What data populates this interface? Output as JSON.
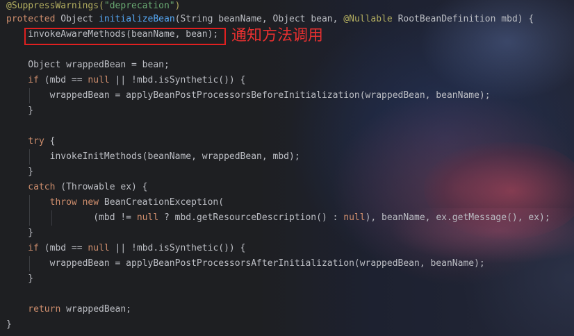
{
  "annotation_note": "通知方法调用",
  "colors": {
    "keyword": "#cf8e6d",
    "annotation": "#b3ae60",
    "string": "#6aab73",
    "function": "#56a8f5",
    "text": "#bcbec4",
    "highlight_box": "#e02020",
    "note_text": "#e53030"
  },
  "code": {
    "lines": [
      [
        [
          "ann",
          "@SuppressWarnings("
        ],
        [
          "str",
          "\"deprecation\""
        ],
        [
          "ann",
          ")"
        ]
      ],
      [
        [
          "kw",
          "protected "
        ],
        [
          "",
          "Object "
        ],
        [
          "fn",
          "initializeBean"
        ],
        [
          "",
          "(String beanName, Object bean, "
        ],
        [
          "ann",
          "@Nullable "
        ],
        [
          "",
          "RootBeanDefinition mbd) {"
        ]
      ],
      [
        [
          "",
          "    invokeAwareMethods(beanName, bean);"
        ]
      ],
      [],
      [
        [
          "",
          "    Object wrappedBean = bean;"
        ]
      ],
      [
        [
          "kw",
          "    if "
        ],
        [
          "",
          "(mbd == "
        ],
        [
          "kw",
          "null"
        ],
        [
          "",
          " || !mbd.isSynthetic()) {"
        ]
      ],
      [
        [
          "",
          "        wrappedBean = applyBeanPostProcessorsBeforeInitialization(wrappedBean, beanName);"
        ]
      ],
      [
        [
          "",
          "    }"
        ]
      ],
      [],
      [
        [
          "kw",
          "    try "
        ],
        [
          "",
          "{"
        ]
      ],
      [
        [
          "",
          "        invokeInitMethods(beanName, wrappedBean, mbd);"
        ]
      ],
      [
        [
          "",
          "    }"
        ]
      ],
      [
        [
          "kw",
          "    catch "
        ],
        [
          "",
          "(Throwable ex) {"
        ]
      ],
      [
        [
          "kw",
          "        throw new "
        ],
        [
          "",
          "BeanCreationException("
        ]
      ],
      [
        [
          "",
          "                (mbd != "
        ],
        [
          "kw",
          "null"
        ],
        [
          "",
          " ? mbd.getResourceDescription() : "
        ],
        [
          "kw",
          "null"
        ],
        [
          "",
          "), beanName, ex.getMessage(), ex);"
        ]
      ],
      [
        [
          "",
          "    }"
        ]
      ],
      [
        [
          "kw",
          "    if "
        ],
        [
          "",
          "(mbd == "
        ],
        [
          "kw",
          "null"
        ],
        [
          "",
          " || !mbd.isSynthetic()) {"
        ]
      ],
      [
        [
          "",
          "        wrappedBean = applyBeanPostProcessorsAfterInitialization(wrappedBean, beanName);"
        ]
      ],
      [
        [
          "",
          "    }"
        ]
      ],
      [],
      [
        [
          "kw",
          "    return "
        ],
        [
          "",
          "wrappedBean;"
        ]
      ],
      [
        [
          "",
          "}"
        ]
      ]
    ]
  }
}
